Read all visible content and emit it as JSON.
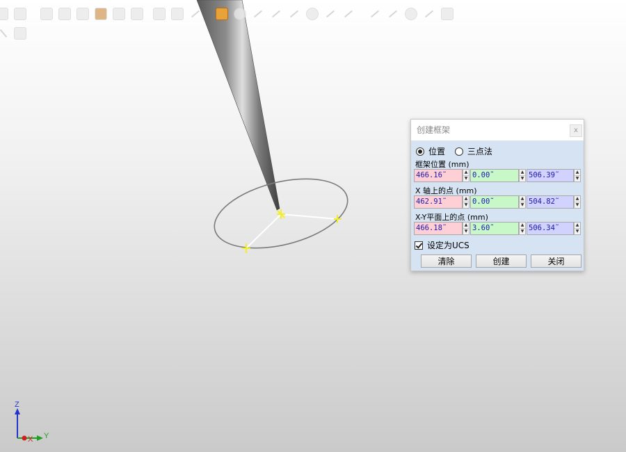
{
  "toolbar": {
    "icons": [
      "zoom-extents-icon",
      "grid-icon",
      "camera-rotate-icon",
      "frame-icon",
      "box-icon",
      "material-sphere-icon",
      "image-icon",
      "settings-gear-icon",
      "target-icon",
      "sphere-icon",
      "measure-icon",
      "frame-points-icon",
      "circle-icon",
      "line-icon",
      "polyline-icon",
      "fork-icon",
      "point-circle-icon",
      "angle-icon",
      "star-icon",
      "arrow-diagonal-icon",
      "curve-icon",
      "tangent-circle-icon",
      "dimension-icon",
      "copy-icon"
    ],
    "active_icon": "frame-points-icon",
    "active_color": "#e8a23a"
  },
  "viewport": {
    "axis_labels": {
      "z": "Z",
      "x": "X",
      "y": "Y"
    },
    "colors": {
      "z": "#2233cc",
      "x": "#d41e1e",
      "y": "#1fa11f",
      "frame_marker": "#f2ee2a",
      "circle": "#7a7a7a"
    }
  },
  "dialog": {
    "title": "创建框架",
    "close_label": "x",
    "radio": {
      "option1": "位置",
      "option2": "三点法",
      "selected": "位置"
    },
    "frame_position": {
      "label": "框架位置 (mm)",
      "x": "466.16˜",
      "y": "0.00˜",
      "z": "506.39˜"
    },
    "x_axis_point": {
      "label": "X 轴上的点 (mm)",
      "x": "462.91˜",
      "y": "0.00˜",
      "z": "504.82˜"
    },
    "xy_plane_point": {
      "label": "X-Y平面上的点 (mm)",
      "x": "466.18˜",
      "y": "3.60˜",
      "z": "506.34˜"
    },
    "set_ucs": {
      "label": "设定为UCS",
      "checked": true
    },
    "buttons": {
      "clear": "清除",
      "create": "创建",
      "close": "关闭"
    },
    "field_colors": {
      "x": "#ffcfd6",
      "y": "#c8f7c8",
      "z": "#d2d2ff"
    }
  }
}
